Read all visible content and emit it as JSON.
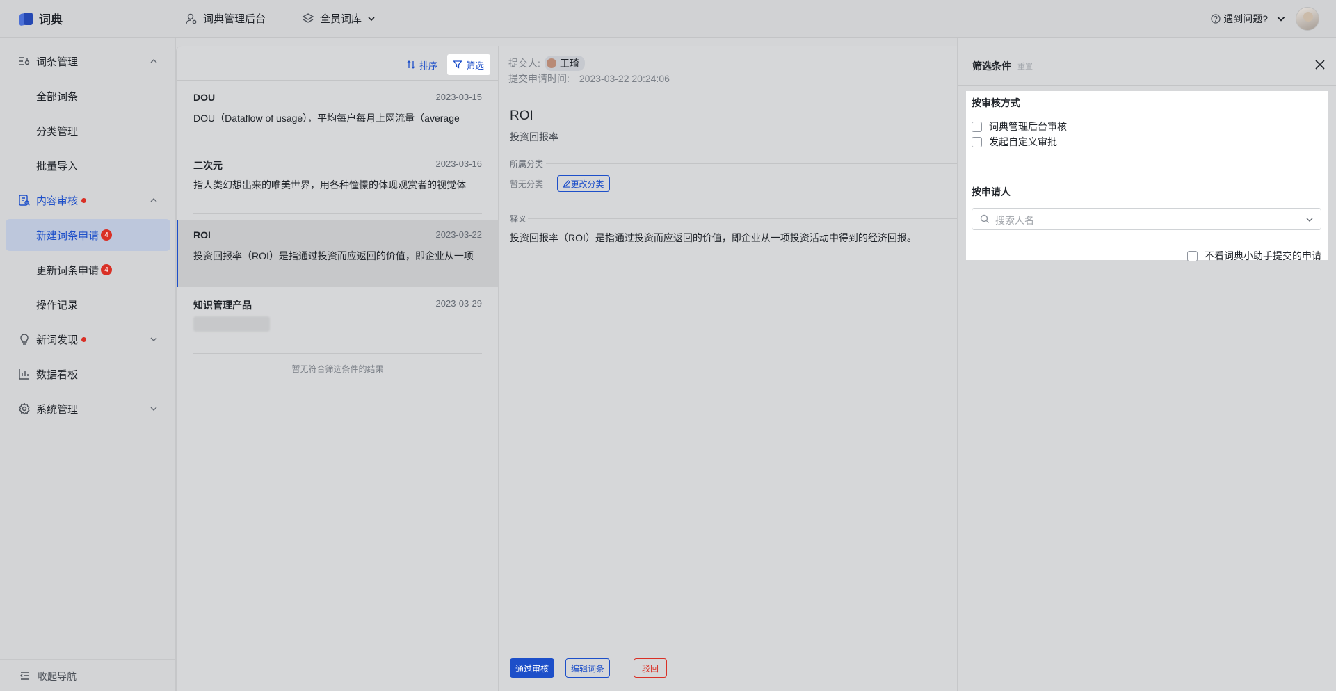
{
  "header": {
    "app_title": "词典",
    "nav_admin": "词典管理后台",
    "nav_library": "全员词库",
    "help": "遇到问题?"
  },
  "sidebar": {
    "items": [
      {
        "label": "词条管理",
        "icon": "entry-manage-icon"
      },
      {
        "label": "全部词条"
      },
      {
        "label": "分类管理"
      },
      {
        "label": "批量导入"
      },
      {
        "label": "内容审核",
        "icon": "review-icon"
      },
      {
        "label": "新建词条申请",
        "badge": "4"
      },
      {
        "label": "更新词条申请",
        "badge": "4"
      },
      {
        "label": "操作记录"
      },
      {
        "label": "新词发现",
        "icon": "bulb-icon"
      },
      {
        "label": "数据看板",
        "icon": "chart-icon"
      },
      {
        "label": "系统管理",
        "icon": "gear-icon"
      }
    ],
    "collapse": "收起导航"
  },
  "list": {
    "sort": "排序",
    "filter": "筛选",
    "items": [
      {
        "title": "DOU",
        "date": "2023-03-15",
        "desc": "DOU（Dataflow of usage），平均每户每月上网流量（average"
      },
      {
        "title": "二次元",
        "date": "2023-03-16",
        "desc": "指人类幻想出来的唯美世界，用各种憧憬的体现观赏者的视觉体"
      },
      {
        "title": "ROI",
        "date": "2023-03-22",
        "desc": "投资回报率（ROI）是指通过投资而应返回的价值，即企业从一项"
      },
      {
        "title": "知识管理产品",
        "date": "2023-03-29",
        "desc": ""
      }
    ],
    "empty_note": "暂无符合筛选条件的结果"
  },
  "detail": {
    "submitter_label": "提交人:",
    "submitter_name": "王琦",
    "submit_time_label": "提交申请时间:",
    "submit_time": "2023-03-22 20:24:06",
    "term": "ROI",
    "alias": "投资回报率",
    "category_label": "所属分类",
    "category_value": "暂无分类",
    "change_category": "更改分类",
    "definition_label": "释义",
    "definition": "投资回报率（ROI）是指通过投资而应返回的价值，即企业从一项投资活动中得到的经济回报。",
    "approve": "通过审核",
    "edit": "编辑词条",
    "reject": "驳回"
  },
  "drawer": {
    "title": "筛选条件",
    "reset": "重置",
    "by_review": "按审核方式",
    "options": [
      "词典管理后台审核",
      "发起自定义审批"
    ],
    "by_applicant": "按申请人",
    "search_placeholder": "搜索人名",
    "exclude_assistant": "不看词典小助手提交的申请"
  },
  "colors": {
    "accent": "#1d4fc9",
    "danger": "#d93026",
    "filter_card": "#ffffff"
  }
}
